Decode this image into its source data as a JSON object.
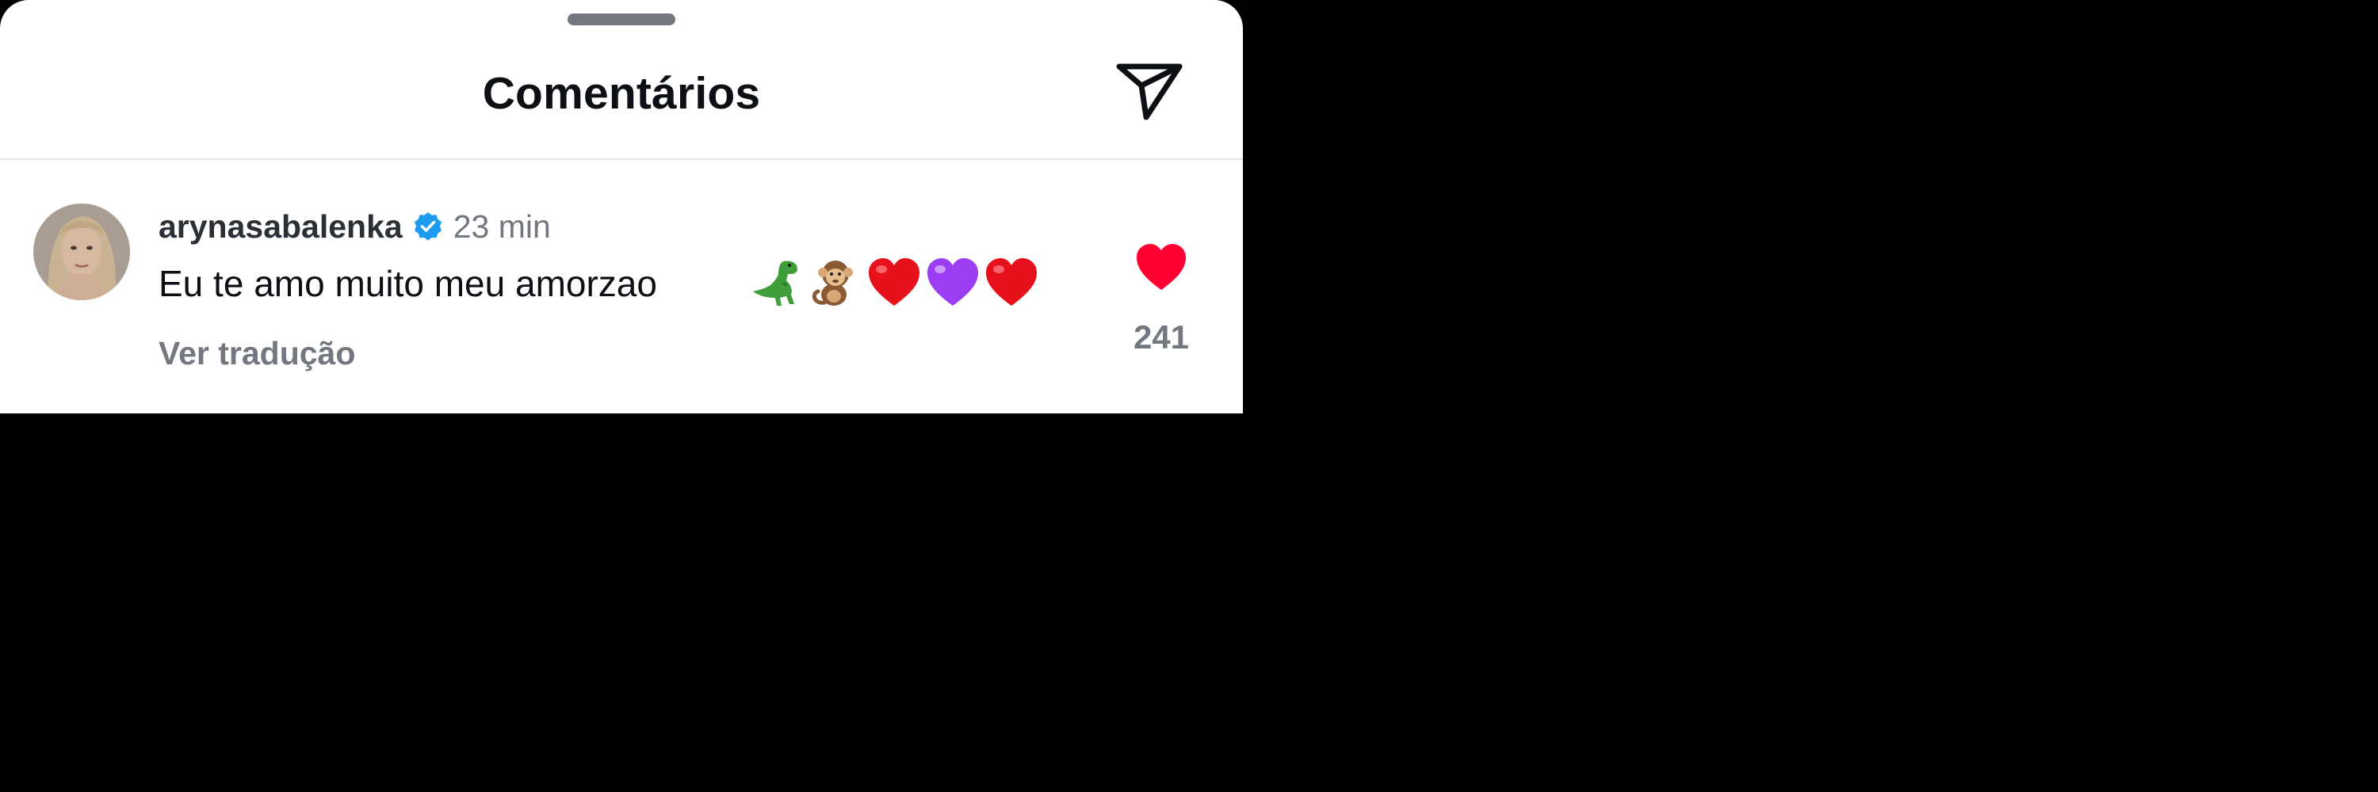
{
  "header": {
    "title": "Comentários",
    "share_icon": "paper-plane-icon"
  },
  "comment": {
    "username": "arynasabalenka",
    "verified": true,
    "verified_icon": "verified-badge-icon",
    "time": "23 min",
    "text": "Eu te amo muito meu amorzao",
    "emojis": [
      "t-rex-emoji",
      "monkey-emoji",
      "red-heart-emoji",
      "purple-heart-emoji",
      "red-heart-emoji"
    ],
    "translate_label": "Ver tradução",
    "liked": true,
    "like_icon": "heart-icon",
    "like_count": "241"
  },
  "colors": {
    "like": "#ff0033",
    "verified": "#1d9bf0",
    "muted_text": "#737780",
    "primary_text": "#0c0f14"
  }
}
